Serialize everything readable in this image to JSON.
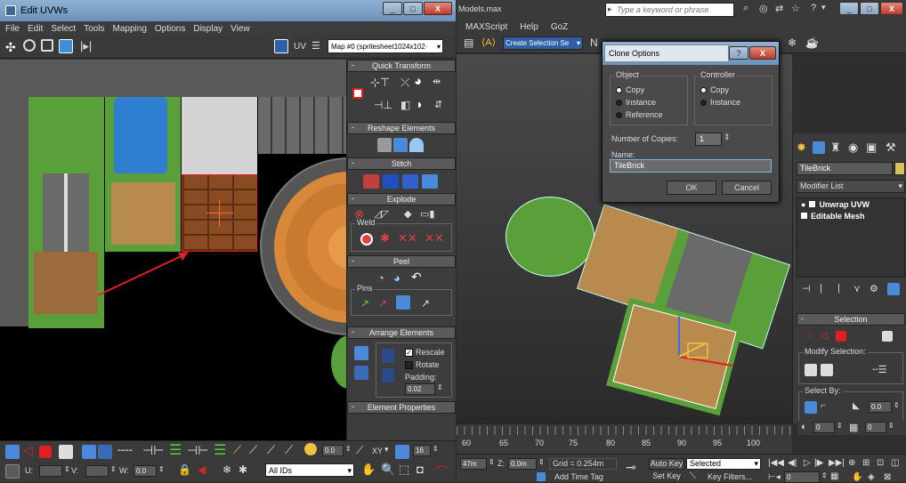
{
  "left_window": {
    "title": "Edit UVWs",
    "menus": [
      "File",
      "Edit",
      "Select",
      "Tools",
      "Mapping",
      "Options",
      "Display",
      "View"
    ],
    "uv_label": "UV",
    "map_dropdown": "Map #0 (spritesheet1024x102·",
    "rollouts": {
      "quick_transform": "Quick Transform",
      "reshape_elements": "Reshape Elements",
      "stitch": "Stitch",
      "explode": "Explode",
      "weld": "Weld",
      "peel": "Peel",
      "pins": "Pins",
      "arrange_elements": "Arrange Elements",
      "rescale": "Rescale",
      "rotate": "Rotate",
      "padding_label": "Padding:",
      "padding_value": "0.02",
      "element_properties": "Element Properties"
    },
    "bottom": {
      "value1": "0.0",
      "xy_label": "XY",
      "value2": "16",
      "u_label": "U:",
      "v_label": "V:",
      "w_label": "W:",
      "w_value": "0.0",
      "ids_dropdown": "All IDs"
    }
  },
  "right_window": {
    "title": "Models.max",
    "search_placeholder": "Type a keyword or phrase",
    "menus": [
      "MAXScript",
      "Help",
      "GoZ"
    ],
    "selection_set": "Create Selection Se",
    "object_name": "TileBrick",
    "modifier_list": "Modifier List",
    "stack": [
      "Unwrap UVW",
      "Editable Mesh"
    ],
    "selection_rollout": "Selection",
    "modify_selection": "Modify Selection:",
    "select_by": "Select By:",
    "select_by_value": "0.0",
    "spin1": "0",
    "spin2": "0",
    "timeline_ticks": [
      "60",
      "65",
      "70",
      "75",
      "80",
      "85",
      "90",
      "95",
      "100"
    ],
    "status": {
      "coord_x": "47m",
      "z_label": "Z:",
      "z_value": "0.0m",
      "grid": "Grid = 0.254m",
      "add_time_tag": "Add Time Tag",
      "auto_key": "Auto Key",
      "auto_key_value": "Selected",
      "set_key": "Set Key",
      "key_filters": "Key Filters...",
      "frame": "0"
    }
  },
  "dialog": {
    "title": "Clone Options",
    "object_group": "Object",
    "object_options": [
      "Copy",
      "Instance",
      "Reference"
    ],
    "controller_group": "Controller",
    "controller_options": [
      "Copy",
      "Instance"
    ],
    "copies_label": "Number of Copies:",
    "copies_value": "1",
    "name_label": "Name:",
    "name_value": "TileBrick",
    "ok": "OK",
    "cancel": "Cancel"
  },
  "colors": {
    "grass": "#5aa03a",
    "water": "#2e7fd0",
    "dirt": "#9b6b3e",
    "brick": "#8a4a22",
    "wood": "#d9883a",
    "ui_panel": "#3d3d3d",
    "selection_red": "#e02020"
  }
}
